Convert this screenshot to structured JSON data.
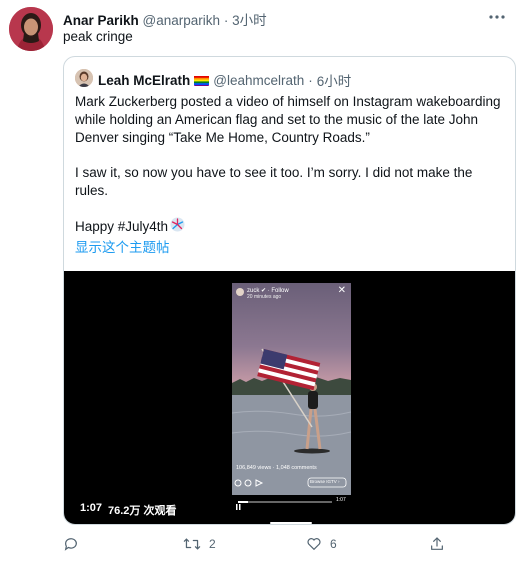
{
  "tweet": {
    "author_name": "Anar Parikh",
    "handle": "@anarparikh",
    "separator": "·",
    "time": "3小时",
    "text": "peak cringe"
  },
  "quote": {
    "author_name": "Leah McElrath",
    "handle": "@leahmcelrath",
    "separator": "·",
    "time": "6小时",
    "para1": "Mark Zuckerberg posted a video of himself on Instagram wakeboarding while holding an American flag and set to the music of the late John Denver singing “Take Me Home, Country Roads.”",
    "para2": "I saw it, so now you have to see it too. I’m sorry. I did not make the rules.",
    "para3": "Happy #July4th",
    "show_thread": "显示这个主题帖"
  },
  "video": {
    "duration": "1:07",
    "views": "76.2万 次观看",
    "ig_user": "zuck ✔ · Follow",
    "ig_time": "20 minutes ago",
    "ig_views": "106,849 views · 1,048 comments",
    "ig_button": "Browse IGTV ›",
    "ig_elapsed": "1:07"
  },
  "actions": {
    "retweets": "2",
    "likes": "6"
  },
  "colors": {
    "link": "#1d9bf0",
    "muted": "#536471",
    "border": "#cfd9de"
  }
}
